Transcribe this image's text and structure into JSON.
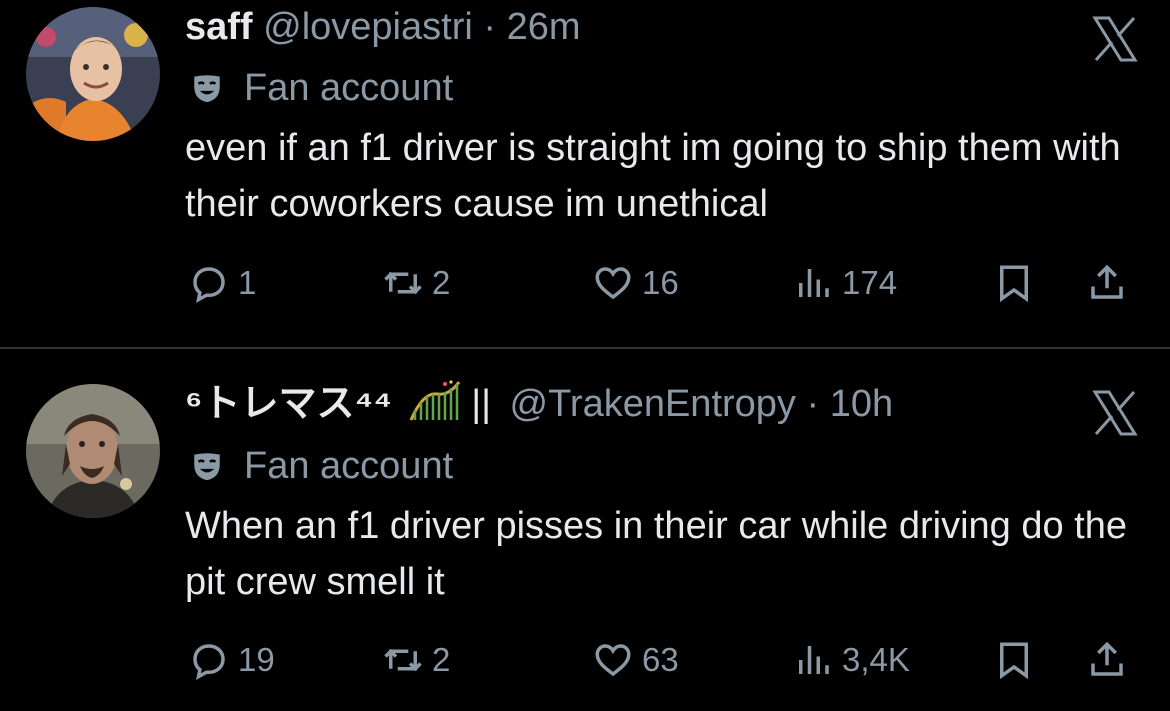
{
  "colors": {
    "background": "#000000",
    "text_primary": "#e7e9ea",
    "text_secondary": "#8b98a5",
    "divider": "#2f3336"
  },
  "tweets": [
    {
      "display_name": "saff",
      "handle": "@lovepiastri",
      "separator": "·",
      "time": "26m",
      "label_icon": "theater-mask-icon",
      "label": "Fan account",
      "text": "even if an f1 driver is straight im going to ship them with their coworkers cause im unethical",
      "replies": "1",
      "retweets": "2",
      "likes": "16",
      "views": "174",
      "close_icon": "x-logo-icon"
    },
    {
      "display_name": "⁶トレマス⁴⁴",
      "display_name_suffix": "||",
      "handle": "@TrakenEntropy",
      "separator": "·",
      "time": "10h",
      "label_icon": "theater-mask-icon",
      "label": "Fan account",
      "text": "When an f1 driver pisses in their car while driving do the pit crew smell it",
      "replies": "19",
      "retweets": "2",
      "likes": "63",
      "views": "3,4K",
      "close_icon": "x-logo-icon"
    }
  ]
}
